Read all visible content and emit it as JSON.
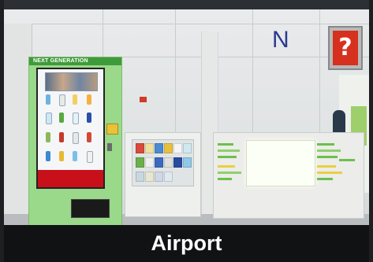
{
  "caption": "Airport",
  "signs": {
    "gate_letter": "N",
    "help_symbol": "?"
  },
  "vending_machine": {
    "band_text": "NEXT GENERATION"
  }
}
